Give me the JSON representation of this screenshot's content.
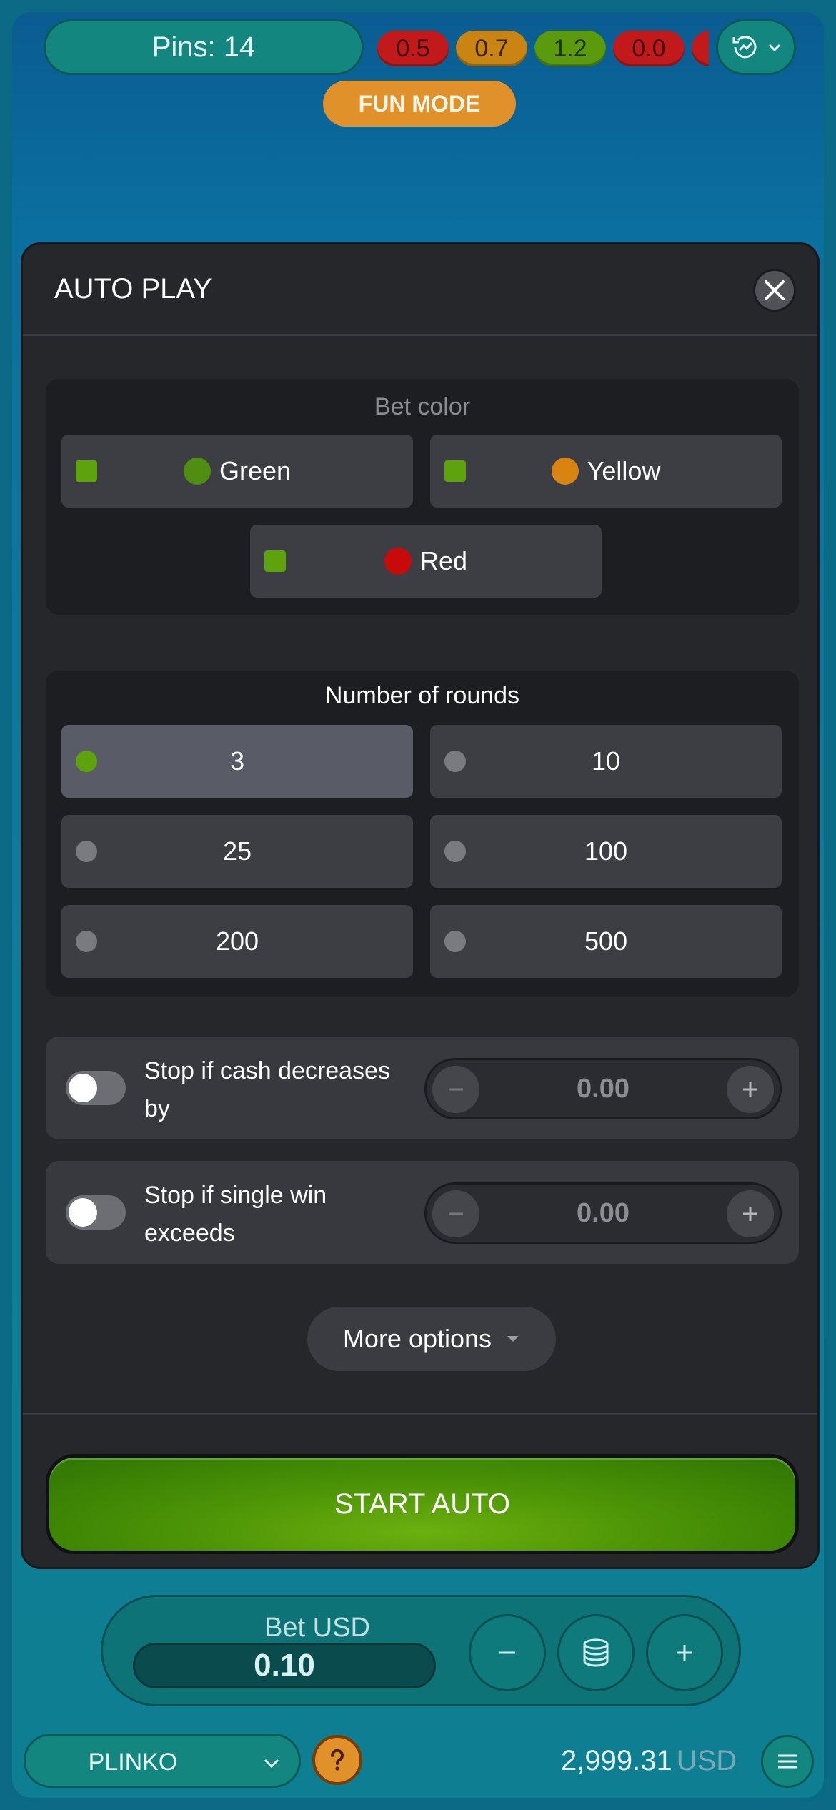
{
  "top_bar": {
    "pins_label": "Pins: 14",
    "history": [
      {
        "value": "0.5",
        "color": "red"
      },
      {
        "value": "0.7",
        "color": "yellow"
      },
      {
        "value": "1.2",
        "color": "green"
      },
      {
        "value": "0.0",
        "color": "red"
      }
    ],
    "fun_mode": "FUN MODE"
  },
  "auto_play": {
    "title": "AUTO PLAY",
    "bet_color": {
      "title": "Bet color",
      "options": [
        {
          "label": "Green",
          "dot_color": "#4f8e10",
          "checked": true
        },
        {
          "label": "Yellow",
          "dot_color": "#d98310",
          "checked": true
        },
        {
          "label": "Red",
          "dot_color": "#c80a0a",
          "checked": true
        }
      ]
    },
    "rounds": {
      "title": "Number of rounds",
      "options": [
        "3",
        "10",
        "25",
        "100",
        "200",
        "500"
      ],
      "selected": "3"
    },
    "stop_cash": {
      "label": "Stop if cash decreases by",
      "value": "0.00",
      "enabled": false
    },
    "stop_win": {
      "label": "Stop if single win exceeds",
      "value": "0.00",
      "enabled": false
    },
    "more_options": "More options",
    "start_auto": "START AUTO"
  },
  "bet": {
    "label": "Bet USD",
    "value": "0.10"
  },
  "footer": {
    "game": "PLINKO",
    "balance": "2,999.31",
    "currency": "USD"
  },
  "colors": {
    "accent_green": "#5ea30e",
    "fun_mode": "#e1912a",
    "teal": "#13877f"
  }
}
